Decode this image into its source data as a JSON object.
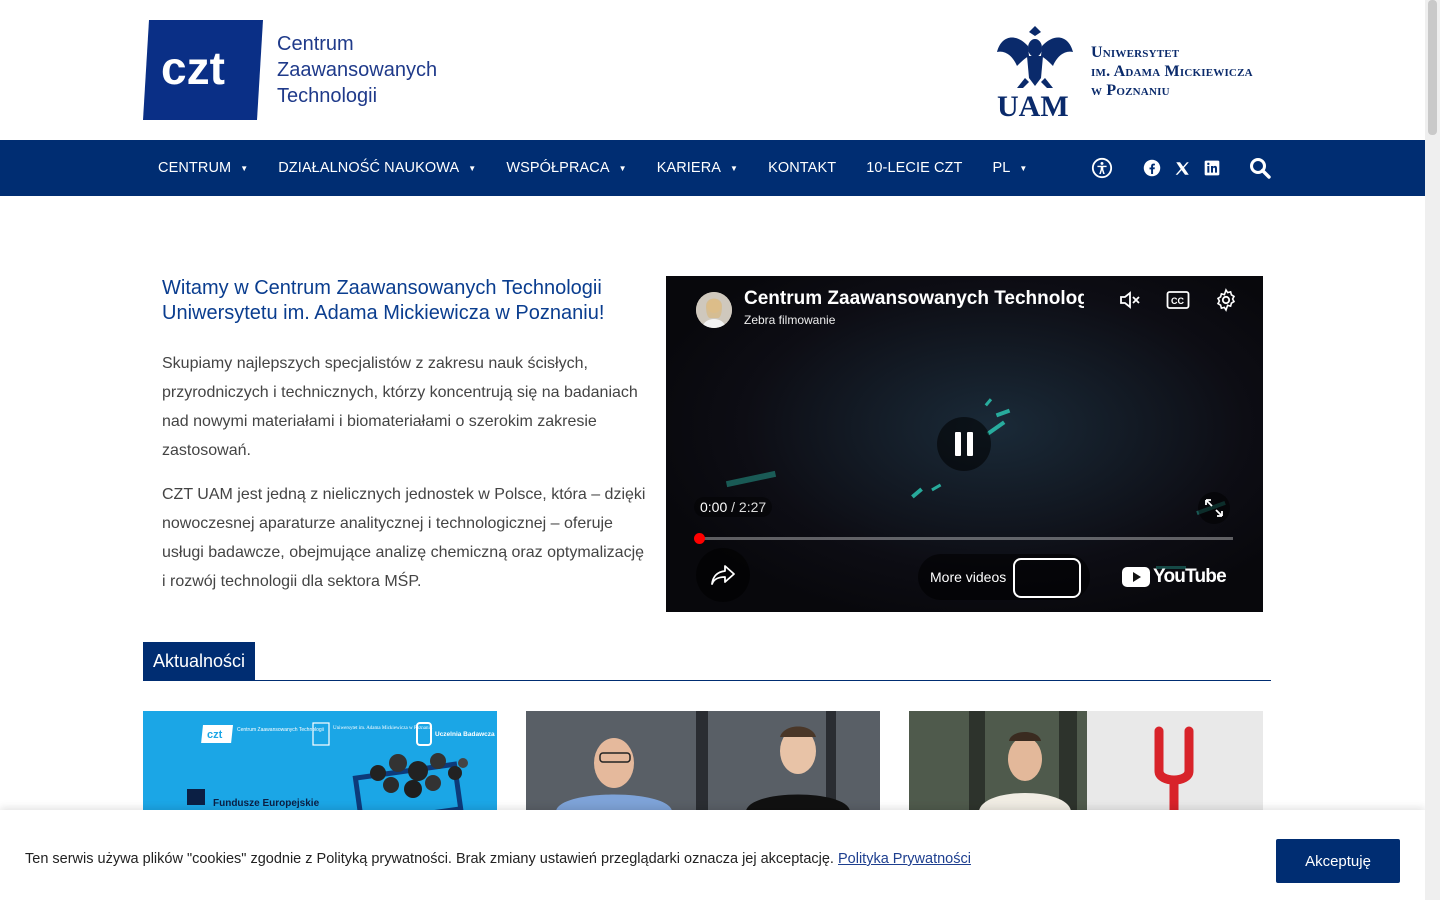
{
  "header": {
    "czt_badge_text": "czt",
    "czt_lines": [
      "Centrum",
      "Zaawansowanych",
      "Technologii"
    ],
    "uam_crest_text": "UAM",
    "uam_lines": [
      "Uniwersytet",
      "im. Adama Mickiewicza",
      "w Poznaniu"
    ]
  },
  "nav": {
    "items": [
      {
        "label": "CENTRUM",
        "dropdown": true
      },
      {
        "label": "DZIAŁALNOŚĆ NAUKOWA",
        "dropdown": true
      },
      {
        "label": "WSPÓŁPRACA",
        "dropdown": true
      },
      {
        "label": "KARIERA",
        "dropdown": true
      },
      {
        "label": "KONTAKT",
        "dropdown": false
      },
      {
        "label": "10-LECIE CZT",
        "dropdown": false
      },
      {
        "label": "PL",
        "dropdown": true
      }
    ],
    "caret": "▼",
    "icons": [
      "accessibility-icon",
      "facebook-icon",
      "x-icon",
      "linkedin-icon",
      "search-icon"
    ]
  },
  "intro": {
    "heading": "Witamy w Centrum Zaawansowanych Technologii Uniwersytetu im. Adama Mickiewicza w Poznaniu!",
    "paragraph1": "Skupiamy najlepszych specjalistów z zakresu nauk ścisłych, przyrodniczych i technicznych, którzy koncentrują się na badaniach nad nowymi materiałami i biomateriałami o szerokim zakresie zastosowań.",
    "paragraph2": "CZT UAM jest jedną z nielicznych jednostek w Polsce, która – dzięki nowoczesnej aparaturze analitycznej i technologicznej – oferuje usługi badawcze, obejmujące analizę chemiczną oraz optymalizację i rozwój technologii dla sektora MŚP."
  },
  "video": {
    "title": "Centrum Zaawansowanych Technologii",
    "channel": "Zebra filmowanie",
    "current_time": "0:00",
    "separator": " / ",
    "duration": "2:27",
    "more_videos": "More videos",
    "youtube_label": "YouTube",
    "progress": 0.0
  },
  "news": {
    "heading": "Aktualności",
    "card1_lines": [
      "Centrum Zaawansowanych Technologii",
      "Uniwersytet im. Adama Mickiewicza w Poznaniu",
      "Uczelnia Badawcza",
      "Fundusze Europejskie"
    ]
  },
  "cookie": {
    "message": "Ten serwis używa plików \"cookies\" zgodnie z Polityką prywatności. Brak zmiany ustawień przeglądarki oznacza jej akceptację.",
    "link": "Polityka Prywatności",
    "accept": "Akceptuję"
  },
  "colors": {
    "brand_navy": "#002d72",
    "heading_blue": "#0a3d8f",
    "progress_red": "#ff0000"
  }
}
